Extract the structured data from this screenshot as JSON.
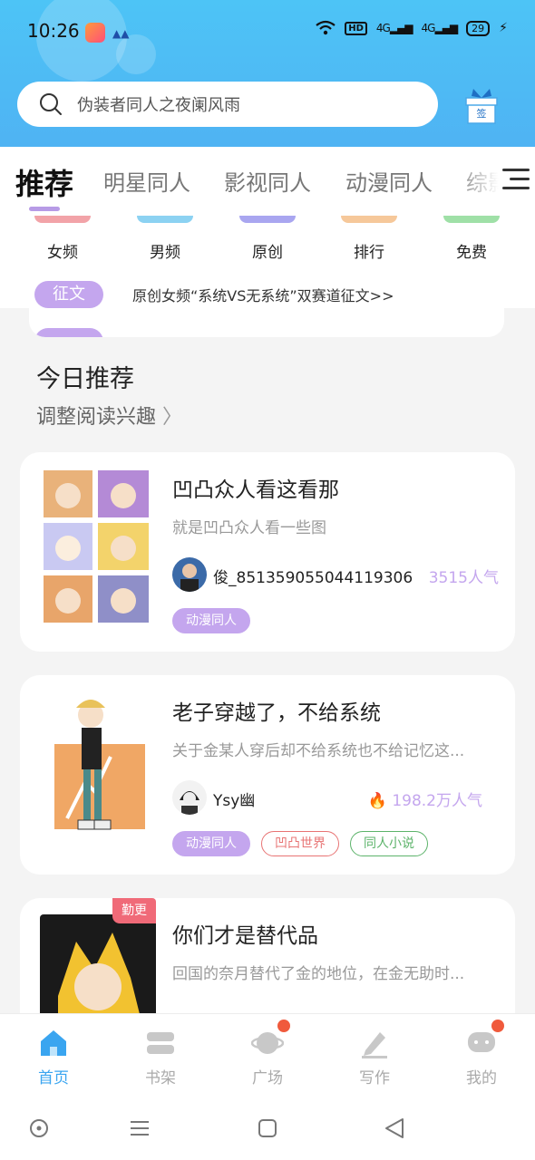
{
  "status_bar": {
    "time": "10:26",
    "hd": "HD",
    "net1": "4G",
    "net2": "4G",
    "battery": "29"
  },
  "search": {
    "placeholder": "伪装者同人之夜阑风雨",
    "gift_label": "签"
  },
  "tabs": [
    {
      "label": "推荐",
      "active": true
    },
    {
      "label": "明星同人"
    },
    {
      "label": "影视同人"
    },
    {
      "label": "动漫同人"
    },
    {
      "label": "综影"
    }
  ],
  "categories": [
    {
      "label": "女频",
      "color": "#f2a3a8"
    },
    {
      "label": "男频",
      "color": "#8cd2f2"
    },
    {
      "label": "原创",
      "color": "#a9a6f0"
    },
    {
      "label": "排行",
      "color": "#f6c89a"
    },
    {
      "label": "免费",
      "color": "#9fe0a7"
    }
  ],
  "notice": {
    "pill": "征文",
    "text": "原创女频“系统VS无系统”双赛道征文>>"
  },
  "today": {
    "title": "今日推荐",
    "adjust": "调整阅读兴趣"
  },
  "cards": [
    {
      "title": "凹凸众人看这看那",
      "desc": "就是凹凸众人看一些图",
      "author": "俊_851359055044119306",
      "popularity": "3515人气",
      "tags": [
        "动漫同人"
      ]
    },
    {
      "title": "老子穿越了，不给系统",
      "desc": "关于金某人穿后却不给系统也不给记忆这...",
      "author": "Ysy幽",
      "popularity": "198.2万人气",
      "tags": [
        "动漫同人",
        "凹凸世界",
        "同人小说"
      ]
    },
    {
      "title": "你们才是替代品",
      "desc": "回国的奈月替代了金的地位，在金无助时...",
      "badge": "勤更"
    }
  ],
  "bottom_nav": [
    {
      "label": "首页",
      "icon": "home-icon",
      "active": true
    },
    {
      "label": "书架",
      "icon": "bookshelf-icon"
    },
    {
      "label": "广场",
      "icon": "planet-icon",
      "dot": true
    },
    {
      "label": "写作",
      "icon": "pen-icon"
    },
    {
      "label": "我的",
      "icon": "chat-icon",
      "dot": true
    }
  ],
  "colors": {
    "accent": "#c4a6ee",
    "header": "#4fb8f4",
    "nav_active": "#3aa5f0"
  }
}
